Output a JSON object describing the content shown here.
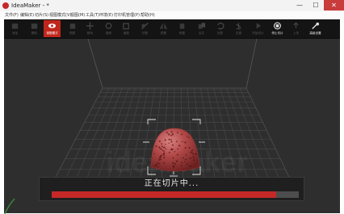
{
  "window": {
    "title": "IdeaMaker - *",
    "minimize": "—",
    "maximize": "☐",
    "close": "✕"
  },
  "menu": [
    "文件(F)",
    "编辑(E)",
    "切片(S)",
    "视图模式(V)",
    "视图(M)",
    "工具(T)",
    "环境(E)",
    "打印机管理(P)",
    "帮助(H)"
  ],
  "toolbar": [
    {
      "label": "添加",
      "icon": "add-icon"
    },
    {
      "label": "删除",
      "icon": "delete-icon"
    },
    {
      "label": "视图模式",
      "icon": "eye-icon",
      "active": true
    },
    {
      "label": "视图",
      "icon": "cube-icon"
    },
    {
      "label": "移动",
      "icon": "move-icon"
    },
    {
      "label": "旋转",
      "icon": "rotate-icon"
    },
    {
      "label": "缩放",
      "icon": "scale-icon"
    },
    {
      "label": "切割",
      "icon": "cut-icon"
    },
    {
      "label": "镜像",
      "icon": "mirror-icon"
    },
    {
      "label": "修复",
      "icon": "repair-icon"
    },
    {
      "label": "合并",
      "icon": "merge-icon"
    },
    {
      "label": "还原",
      "icon": "undo-icon"
    },
    {
      "label": "支撑",
      "icon": "support-icon"
    },
    {
      "label": "开始切片",
      "icon": "play-icon"
    },
    {
      "label": "停止切片",
      "icon": "stop-icon",
      "bright": true
    },
    {
      "label": "上传",
      "icon": "upload-icon"
    },
    {
      "label": "高级设置",
      "icon": "settings-icon",
      "bright": true
    }
  ],
  "watermark": "ideaMaker",
  "progress": {
    "text": "正在切片中...",
    "fraction": 0.91
  },
  "colors": {
    "accent": "#c62828",
    "toolbar_bg": "#141414",
    "viewport_bg": "#2e2e2e"
  }
}
